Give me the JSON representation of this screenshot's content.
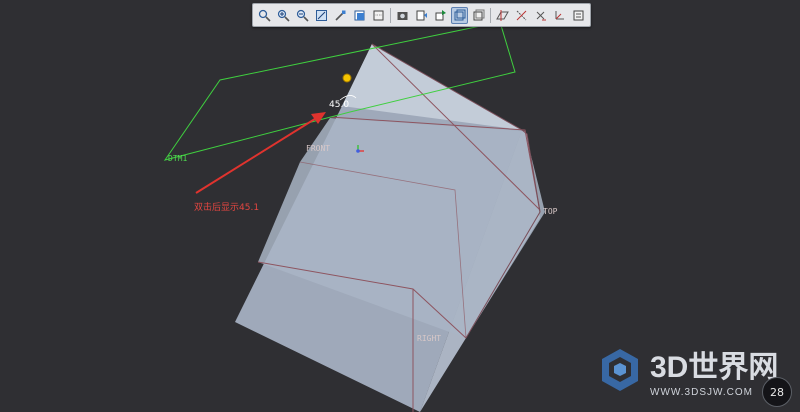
{
  "toolbar": {
    "buttons": [
      {
        "icon": "zoom-window-icon",
        "active": false
      },
      {
        "icon": "zoom-in-icon",
        "active": false
      },
      {
        "icon": "zoom-out-icon",
        "active": false
      },
      {
        "icon": "refit-icon",
        "active": false
      },
      {
        "icon": "repaint-icon",
        "active": false
      },
      {
        "icon": "shading-icon",
        "active": false
      },
      {
        "icon": "hidden-line-icon",
        "active": false
      },
      {
        "icon": "saved-view-icon",
        "active": false
      },
      {
        "icon": "named-view-icon",
        "active": false
      },
      {
        "icon": "reorient-icon",
        "active": false
      },
      {
        "icon": "wireframe-icon",
        "active": true
      },
      {
        "icon": "no-hidden-icon",
        "active": false
      },
      {
        "icon": "datum-plane-display-icon",
        "active": false
      },
      {
        "icon": "datum-axis-display-icon",
        "active": false
      },
      {
        "icon": "datum-point-display-icon",
        "active": false
      },
      {
        "icon": "csys-display-icon",
        "active": false
      },
      {
        "icon": "annotation-display-icon",
        "active": false
      }
    ]
  },
  "scene": {
    "plane_labels": {
      "front": "FRONT",
      "top": "TOP",
      "right": "RIGHT"
    },
    "datum_label": "DTM1",
    "dimension_value": "45.0",
    "annotation": "双击后显示45.1",
    "colors": {
      "background": "#2f2f33",
      "cube_face": "#a8b3c4",
      "datum_plane": "#3fcf3f",
      "plane_edges": "#8e5560",
      "annotation": "#e0332e",
      "handle": "#f5c400"
    }
  },
  "watermark": {
    "title": "3D世界网",
    "url": "WWW.3DSJW.COM"
  },
  "status": {
    "value": "28"
  }
}
